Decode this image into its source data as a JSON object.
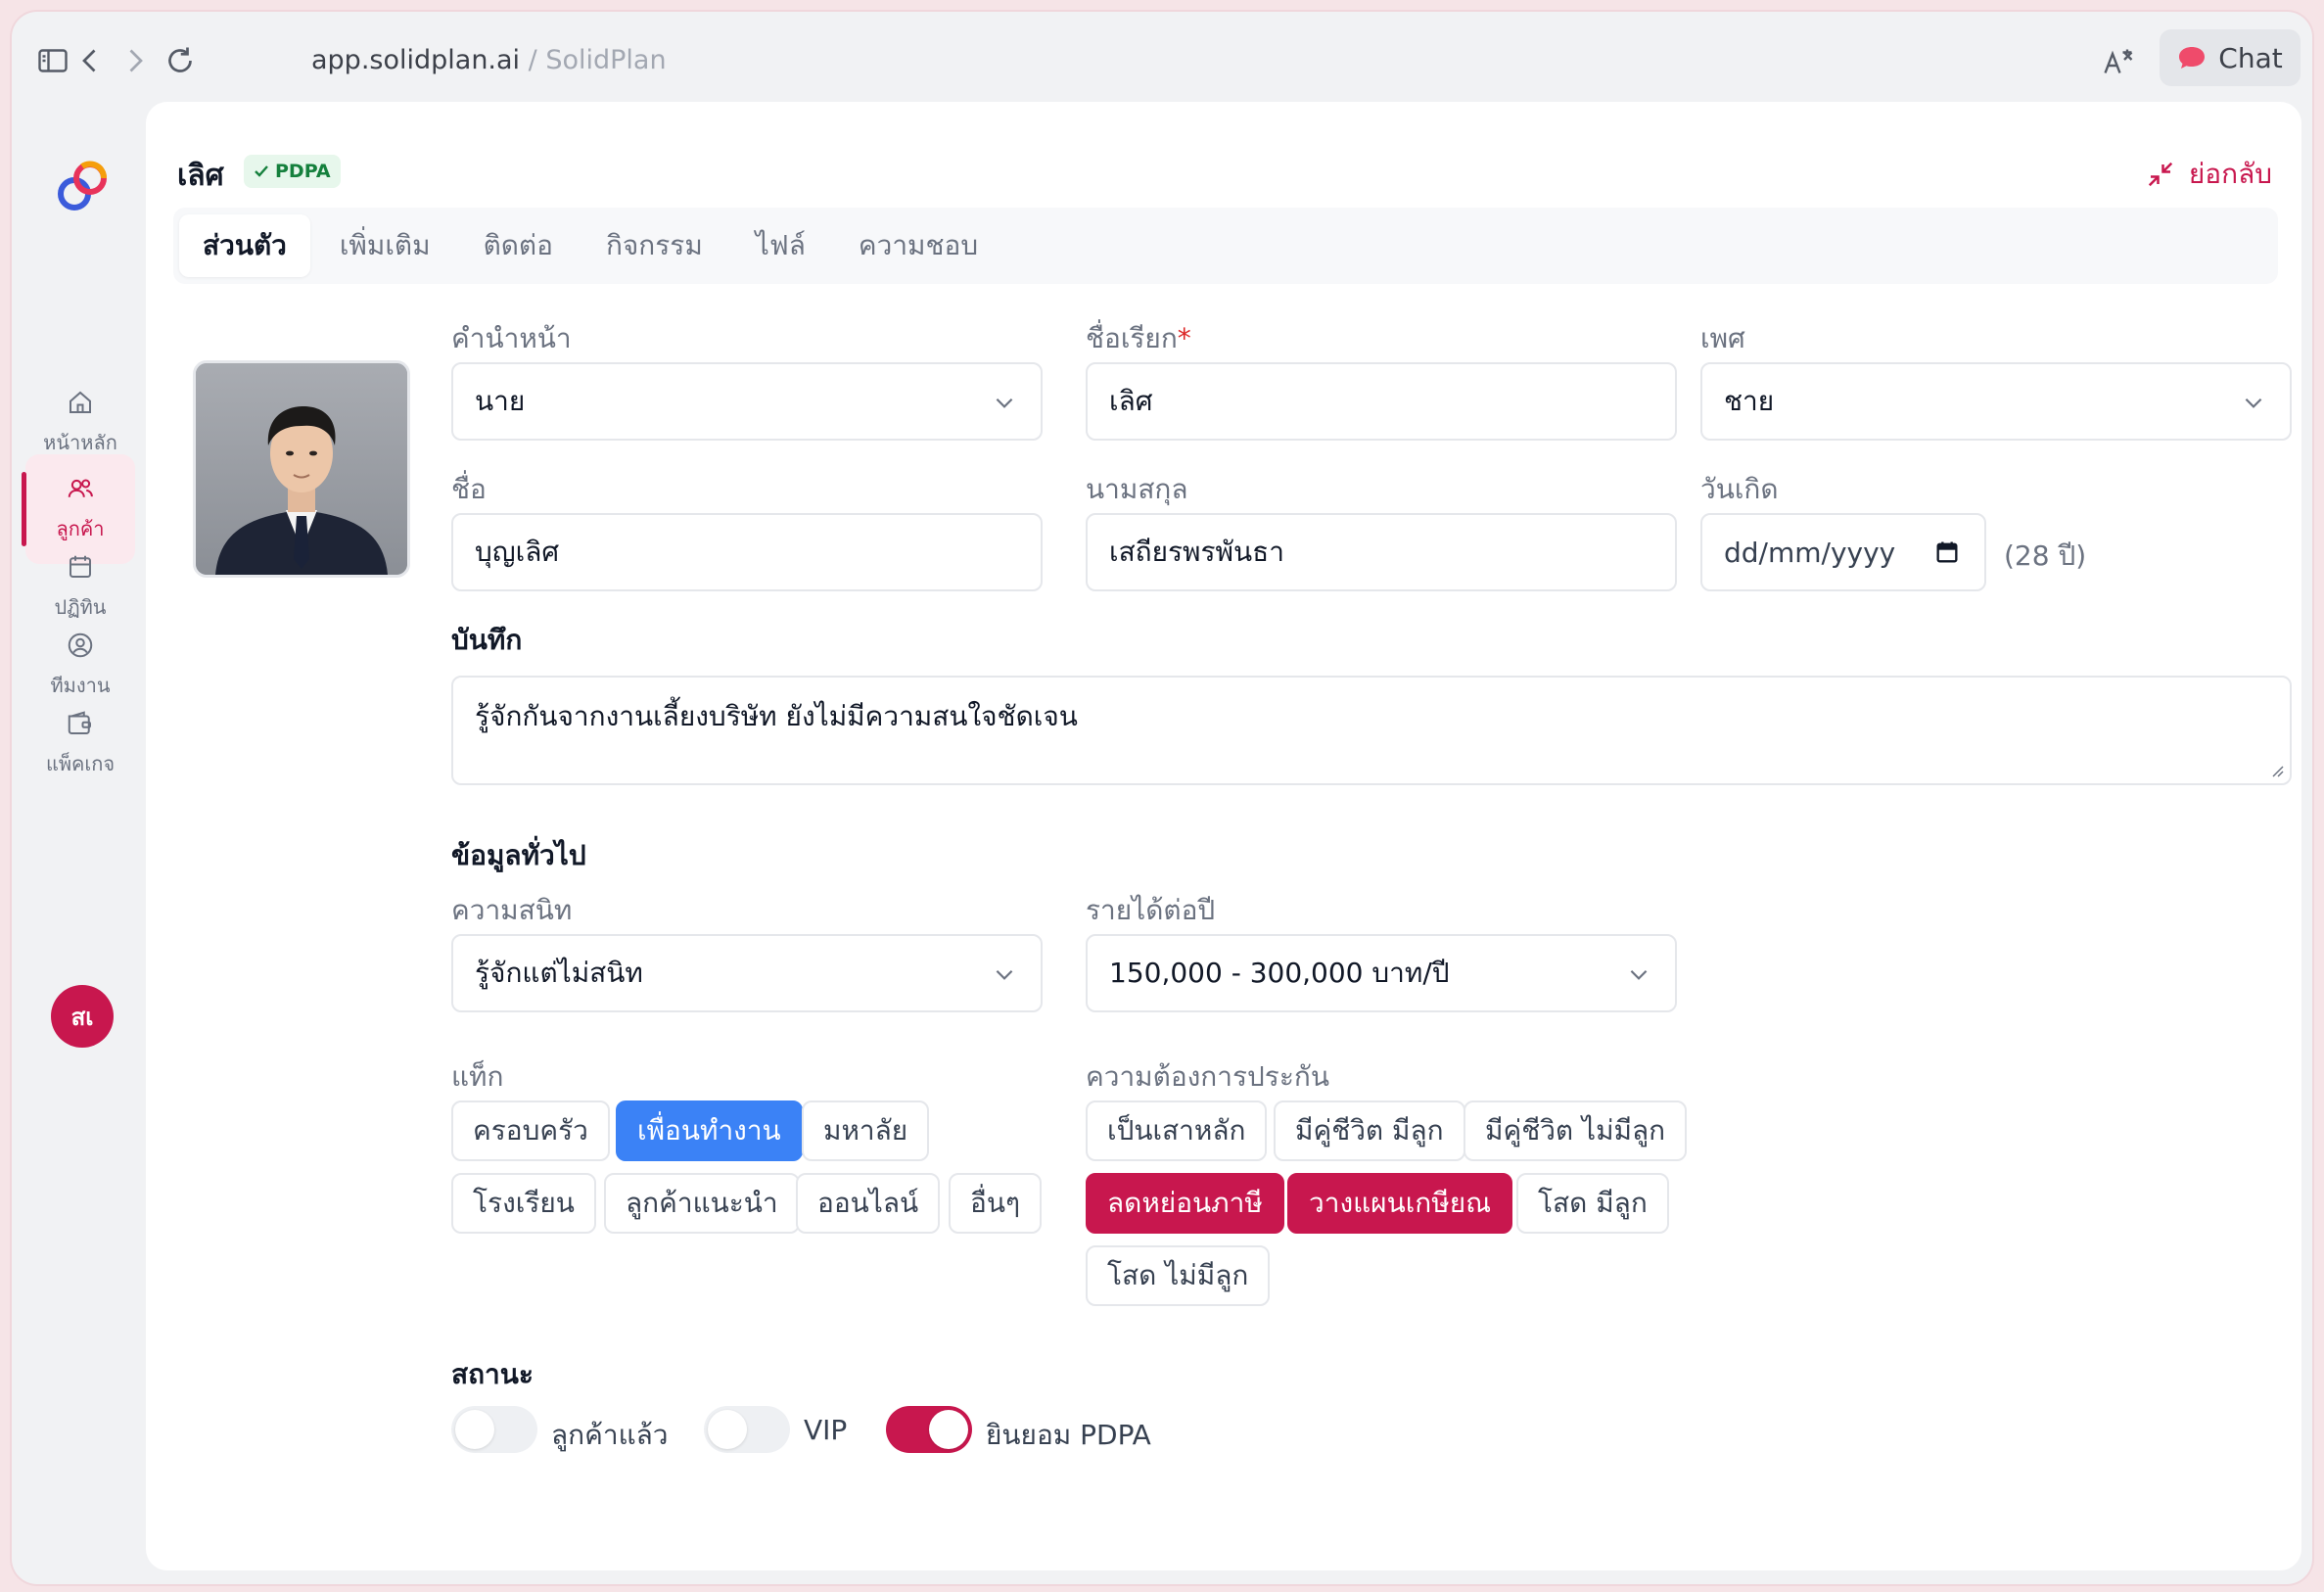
{
  "browser": {
    "url": "app.solidplan.ai",
    "separator": " / ",
    "page_title": "SolidPlan",
    "chat_label": "Chat"
  },
  "sidebar": {
    "items": [
      {
        "label": "หน้าหลัก",
        "icon": "home-icon"
      },
      {
        "label": "ลูกค้า",
        "icon": "users-icon",
        "active": true
      },
      {
        "label": "ปฏิทิน",
        "icon": "calendar-icon"
      },
      {
        "label": "ทีมงาน",
        "icon": "user-circle-icon"
      },
      {
        "label": "แพ็คเกจ",
        "icon": "wallet-icon"
      }
    ],
    "user_initials": "สเ"
  },
  "header": {
    "name": "เลิศ",
    "badge": "PDPA",
    "collapse_label": "ย่อกลับ"
  },
  "tabs": [
    "ส่วนตัว",
    "เพิ่มเติม",
    "ติดต่อ",
    "กิจกรรม",
    "ไฟล์",
    "ความชอบ"
  ],
  "form": {
    "prefix": {
      "label": "คำนำหน้า",
      "value": "นาย"
    },
    "nickname": {
      "label": "ชื่อเรียก",
      "required_mark": "*",
      "value": "เลิศ"
    },
    "gender": {
      "label": "เพศ",
      "value": "ชาย"
    },
    "first_name": {
      "label": "ชื่อ",
      "value": "บุญเลิศ"
    },
    "last_name": {
      "label": "นามสกุล",
      "value": "เสถียรพรพันธา"
    },
    "birthday": {
      "label": "วันเกิด",
      "value": "dd/mm/yyyy",
      "age": "(28 ปี)"
    },
    "note": {
      "label": "บันทึก",
      "value": "รู้จักกันจากงานเลี้ยงบริษัท ยังไม่มีความสนใจชัดเจน"
    }
  },
  "general": {
    "title": "ข้อมูลทั่วไป",
    "closeness": {
      "label": "ความสนิท",
      "value": "รู้จักแต่ไม่สนิท"
    },
    "income": {
      "label": "รายได้ต่อปี",
      "value": "150,000 - 300,000 บาท/ปี"
    }
  },
  "tags": {
    "label": "แท็ก",
    "items": [
      "ครอบครัว",
      "เพื่อนทำงาน",
      "มหาลัย",
      "โรงเรียน",
      "ลูกค้าแนะนำ",
      "ออนไลน์",
      "อื่นๆ"
    ],
    "selected": "เพื่อนทำงาน"
  },
  "insurance_needs": {
    "label": "ความต้องการประกัน",
    "items": [
      "เป็นเสาหลัก",
      "มีคู่ชีวิต มีลูก",
      "มีคู่ชีวิต ไม่มีลูก",
      "ลดหย่อนภาษี",
      "วางแผนเกษียณ",
      "โสด มีลูก",
      "โสด ไม่มีลูก"
    ],
    "selected": [
      "ลดหย่อนภาษี",
      "วางแผนเกษียณ"
    ]
  },
  "status": {
    "title": "สถานะ",
    "toggles": [
      {
        "label": "ลูกค้าแล้ว",
        "on": false
      },
      {
        "label": "VIP",
        "on": false
      },
      {
        "label": "ยินยอม PDPA",
        "on": true
      }
    ]
  },
  "colors": {
    "accent": "#c8174e",
    "tag_blue": "#3b82f6",
    "badge_green": "#15803d"
  }
}
